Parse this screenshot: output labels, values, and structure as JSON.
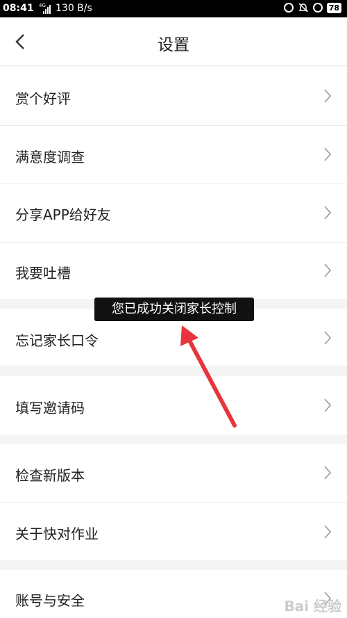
{
  "status_bar": {
    "time": "08:41",
    "network": "4G",
    "speed": "130 B/s",
    "battery": "78"
  },
  "header": {
    "title": "设置"
  },
  "menu": {
    "items": [
      {
        "label": "赏个好评"
      },
      {
        "label": "满意度调查"
      },
      {
        "label": "分享APP给好友"
      },
      {
        "label": "我要吐槽"
      },
      {
        "label": "忘记家长口令"
      },
      {
        "label": "填写邀请码"
      },
      {
        "label": "检查新版本"
      },
      {
        "label": "关于快对作业"
      },
      {
        "label": "账号与安全"
      }
    ]
  },
  "toast": {
    "message": "您已成功关闭家长控制"
  },
  "annotation": {
    "arrow_color": "#e8343c"
  },
  "watermark": {
    "text": "Bai 经验"
  }
}
